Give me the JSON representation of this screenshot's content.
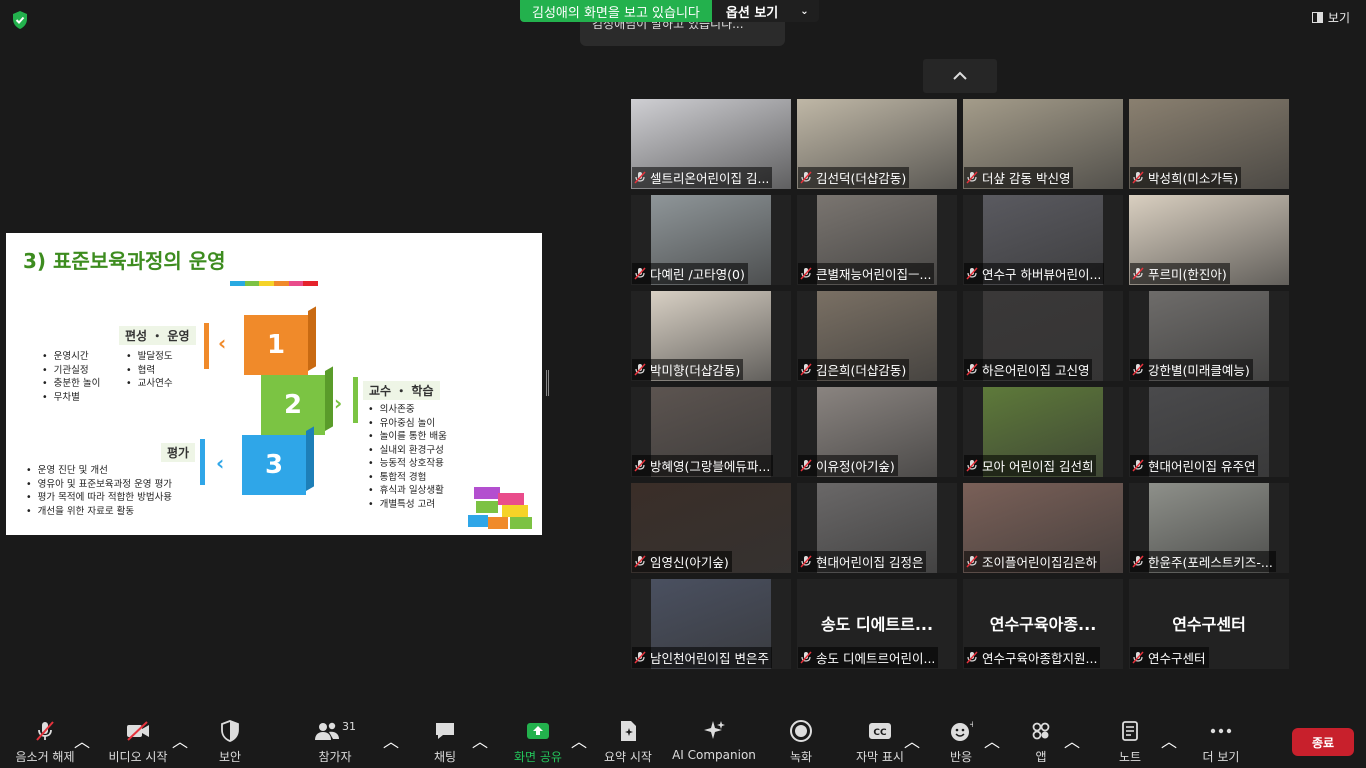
{
  "top": {
    "share_banner": "김성애의 화면을 보고 있습니다",
    "options_label": "옵션 보기",
    "speaking_toast": "김성애님이 말하고 있습니다...",
    "view_label": "보기"
  },
  "slide": {
    "title": "3) 표준보육과정의 운영",
    "color_strip": [
      "#28a9e1",
      "#7cc243",
      "#f5d328",
      "#f08a2a",
      "#e94c8b",
      "#e5232c"
    ],
    "block_numbers": [
      "1",
      "2",
      "3"
    ],
    "section1": {
      "label": "편성 ・ 운영",
      "col1": [
        "운영시간",
        "기관실정",
        "충분한 놀이",
        "무차별"
      ],
      "col2": [
        "발달정도",
        "협력",
        "교사연수"
      ]
    },
    "section2": {
      "label": "교수 ・ 학습",
      "items": [
        "의사존중",
        "유아중심 놀이",
        "놀이를 통한 배움",
        "실내외 환경구성",
        "능동적 상호작용",
        "통합적 경험",
        "휴식과 일상생활",
        "개별특성 고려"
      ]
    },
    "section3": {
      "label": "평가",
      "items": [
        "운영 진단 및 개선",
        "영유아 및 표준보육과정 운영 평가",
        "평가 목적에 따라 적합한 방법사용",
        "개선을 위한 자료로 활동"
      ]
    }
  },
  "participants": [
    {
      "name": "셀트리온어린이집 김...",
      "video": true,
      "color": "#cfcfd3"
    },
    {
      "name": "김선덕(더샵감동)",
      "video": true,
      "color": "#bfb7a6"
    },
    {
      "name": "더샾 감동 박신영",
      "video": true,
      "color": "#a49c8a"
    },
    {
      "name": "박성희(미소가득)",
      "video": true,
      "color": "#8a8070"
    },
    {
      "name": "다예린 /고타영(0)",
      "video": true,
      "color": "#8f9699"
    },
    {
      "name": "큰별재능어린이집ㅡ...",
      "video": true,
      "color": "#7a7570"
    },
    {
      "name": "연수구 하버뷰어린이...",
      "video": true,
      "color": "#5a5a60"
    },
    {
      "name": "푸르미(한진아)",
      "video": true,
      "color": "#d9cfc0"
    },
    {
      "name": "박미향(더샵감동)",
      "video": true,
      "color": "#d8d0c4"
    },
    {
      "name": "김은희(더샵감동)",
      "video": true,
      "color": "#7a7064"
    },
    {
      "name": "하은어린이집 고신영",
      "video": true,
      "color": "#3a3838"
    },
    {
      "name": "강한별(미래클예능)",
      "video": true,
      "color": "#6e6c6a"
    },
    {
      "name": "방혜영(그랑블에듀파...",
      "video": true,
      "color": "#5c5450"
    },
    {
      "name": "이유정(아기숲)",
      "video": true,
      "color": "#8a8480"
    },
    {
      "name": "모아 어린이집 김선희",
      "video": true,
      "color": "#5e7a3a"
    },
    {
      "name": "현대어린이집 유주연",
      "video": true,
      "color": "#4a4a4c"
    },
    {
      "name": "임영신(아기숲)",
      "video": true,
      "color": "#3a2e28"
    },
    {
      "name": "현대어린이집 김정은",
      "video": true,
      "color": "#6a6868"
    },
    {
      "name": "조이플어린이집김은하",
      "video": true,
      "color": "#7a6058"
    },
    {
      "name": "한윤주(포레스트키즈-...",
      "video": true,
      "color": "#8e908a"
    },
    {
      "name": "남인천어린이집 변은주",
      "video": true,
      "color": "#4a5060"
    },
    {
      "name": "송도 디에트르어린이...",
      "video": false,
      "bigname": "송도 디에트르..."
    },
    {
      "name": "연수구육아종합지원...",
      "video": false,
      "bigname": "연수구육아종..."
    },
    {
      "name": "연수구센터",
      "video": false,
      "bigname": "연수구센터"
    }
  ],
  "toolbar": {
    "unmute": "음소거 해제",
    "video": "비디오 시작",
    "security": "보안",
    "participants": "참가자",
    "participant_count": "31",
    "chat": "채팅",
    "share": "화면 공유",
    "summary": "요약 시작",
    "ai": "AI Companion",
    "record": "녹화",
    "captions": "자막 표시",
    "reactions": "반응",
    "apps": "앱",
    "notes": "노트",
    "more": "더 보기",
    "end": "종료"
  }
}
